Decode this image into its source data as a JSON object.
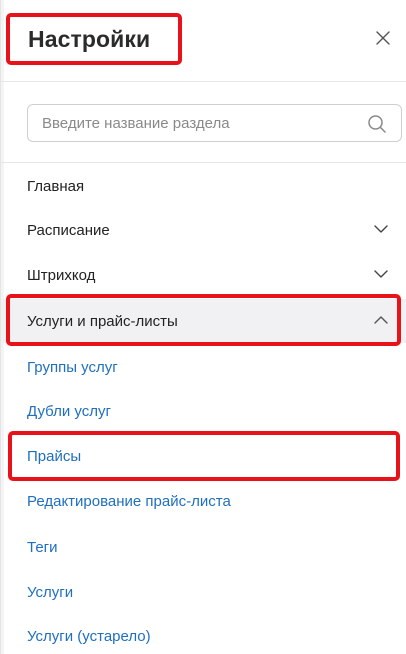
{
  "header": {
    "title": "Настройки",
    "close_icon": "close-icon"
  },
  "search": {
    "placeholder": "Введите название раздела",
    "value": "",
    "icon": "search-icon"
  },
  "menu": {
    "items": [
      {
        "label": "Главная",
        "expandable": false
      },
      {
        "label": "Расписание",
        "expandable": true,
        "expanded": false
      },
      {
        "label": "Штрихкод",
        "expandable": true,
        "expanded": false
      },
      {
        "label": "Услуги и прайс-листы",
        "expandable": true,
        "expanded": true
      }
    ],
    "subitems": [
      {
        "label": "Группы услуг"
      },
      {
        "label": "Дубли услуг"
      },
      {
        "label": "Прайсы"
      },
      {
        "label": "Редактирование прайс-листа"
      },
      {
        "label": "Теги"
      },
      {
        "label": "Услуги"
      },
      {
        "label": "Услуги (устарело)"
      }
    ]
  },
  "colors": {
    "highlight": "#e8131a",
    "link": "#1f6fbf",
    "active_bg": "#f1f1f3"
  }
}
